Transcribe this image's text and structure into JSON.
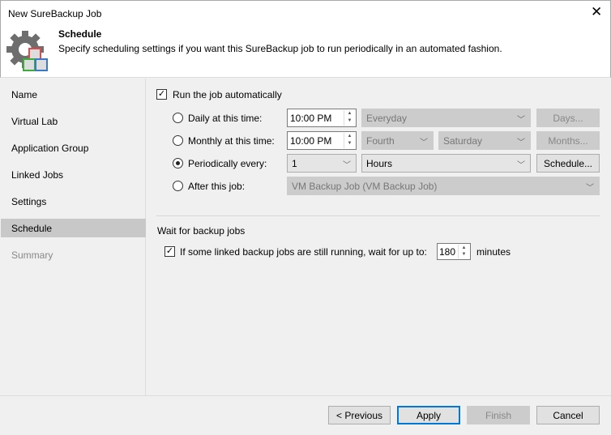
{
  "window": {
    "title": "New SureBackup Job",
    "close": "✕"
  },
  "header": {
    "title": "Schedule",
    "description": "Specify scheduling settings if you want this SureBackup job to run periodically in an automated fashion."
  },
  "sidebar": {
    "items": [
      {
        "label": "Name"
      },
      {
        "label": "Virtual Lab"
      },
      {
        "label": "Application Group"
      },
      {
        "label": "Linked Jobs"
      },
      {
        "label": "Settings"
      },
      {
        "label": "Schedule",
        "selected": true
      },
      {
        "label": "Summary",
        "disabled": true
      }
    ]
  },
  "schedule": {
    "run_auto": {
      "label": "Run the job automatically",
      "checked": true
    },
    "daily": {
      "label": "Daily at this time:",
      "time": "10:00 PM",
      "days_option": "Everyday",
      "button": "Days..."
    },
    "monthly": {
      "label": "Monthly at this time:",
      "time": "10:00 PM",
      "week": "Fourth",
      "day": "Saturday",
      "button": "Months..."
    },
    "periodic": {
      "label": "Periodically every:",
      "value": "1",
      "unit": "Hours",
      "button": "Schedule...",
      "selected": true
    },
    "after": {
      "label": "After this job:",
      "job": "VM Backup Job (VM Backup Job)"
    }
  },
  "wait": {
    "section": "Wait for backup jobs",
    "label": "If some linked backup jobs are still running, wait for up to:",
    "value": "180",
    "unit": "minutes",
    "checked": true
  },
  "footer": {
    "previous": "< Previous",
    "apply": "Apply",
    "finish": "Finish",
    "cancel": "Cancel"
  },
  "colors": {
    "accent": "#0078d7",
    "selected_nav": "#c8c8c8"
  }
}
